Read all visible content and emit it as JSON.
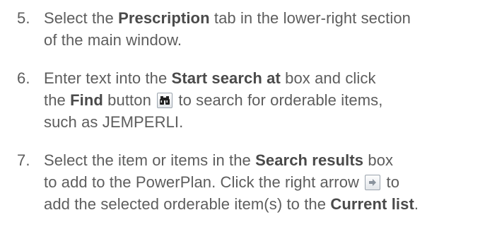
{
  "steps": [
    {
      "number": "5.",
      "line1_pre": "Select the ",
      "line1_bold": "Prescription",
      "line1_post": " tab in the lower-right section",
      "line2": "of the main window."
    },
    {
      "number": "6.",
      "line1_pre": "Enter text into the ",
      "line1_bold": "Start search at",
      "line1_post": " box and click",
      "line2_pre": "the ",
      "line2_bold": "Find",
      "line2_post": " button",
      "line2_after_icon": " to search for orderable items,",
      "line3": "such as JEMPERLI.",
      "icon": "binoculars-icon"
    },
    {
      "number": "7.",
      "line1_pre": "Select the item or items in the ",
      "line1_bold": "Search results",
      "line1_post": " box",
      "line2_pre": "to add to the PowerPlan. Click the right arrow",
      "line2_after_icon": " to",
      "line3_pre": "add the selected orderable item(s) to the ",
      "line3_bold": "Current list",
      "line3_post": ".",
      "icon": "right-arrow-icon"
    }
  ]
}
